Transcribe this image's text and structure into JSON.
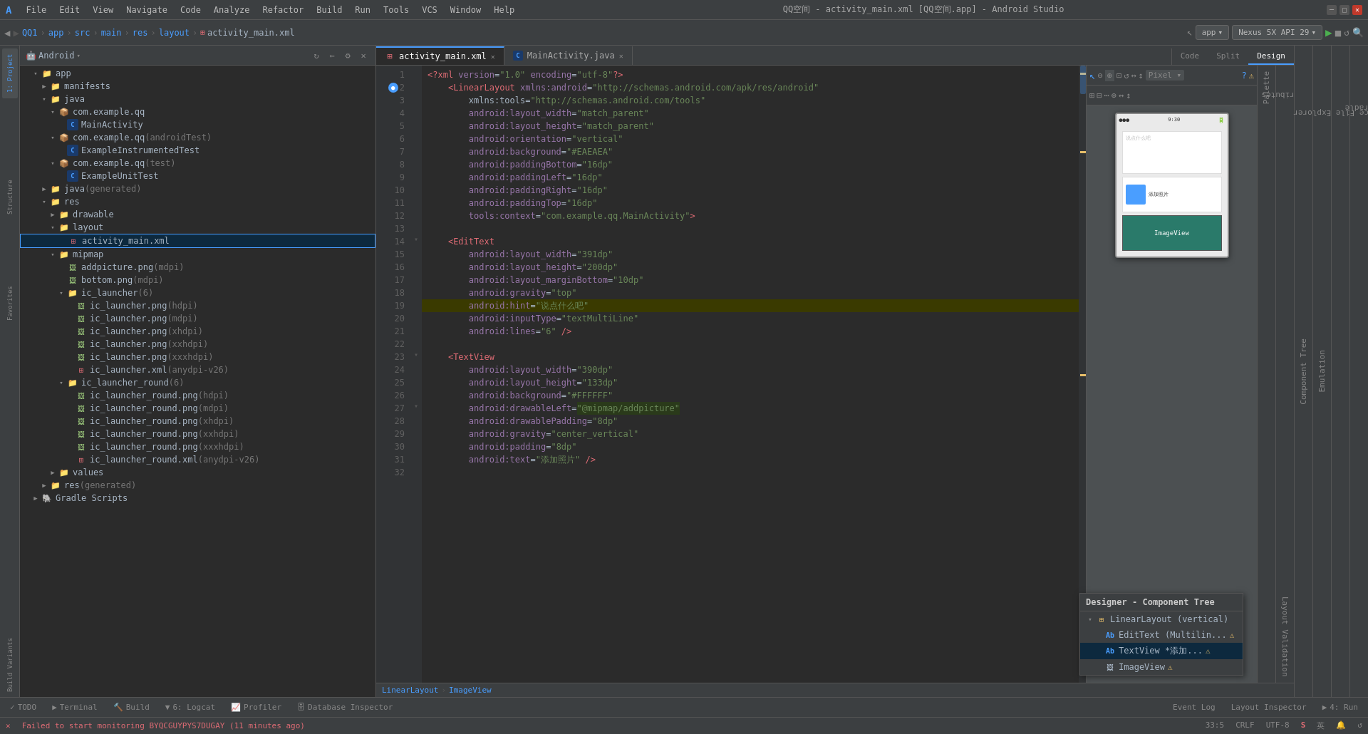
{
  "titleBar": {
    "title": "QQ空间 - activity_main.xml [QQ空间.app] - Android Studio",
    "menus": [
      "File",
      "Edit",
      "View",
      "Navigate",
      "Code",
      "Analyze",
      "Refactor",
      "Build",
      "Run",
      "Tools",
      "VCS",
      "Window",
      "Help"
    ]
  },
  "breadcrumb": {
    "items": [
      "QQ1",
      "app",
      "src",
      "main",
      "res",
      "layout",
      "activity_main.xml"
    ]
  },
  "tabs": [
    {
      "label": "activity_main.xml",
      "active": true
    },
    {
      "label": "MainActivity.java",
      "active": false
    }
  ],
  "rightTabs": [
    {
      "label": "Code",
      "active": false
    },
    {
      "label": "Split",
      "active": false
    },
    {
      "label": "Design",
      "active": true
    }
  ],
  "runConfig": {
    "app": "app",
    "device": "Nexus 5X API 29"
  },
  "projectTree": {
    "items": [
      {
        "label": "app",
        "indent": 1,
        "type": "folder",
        "expanded": true
      },
      {
        "label": "manifests",
        "indent": 2,
        "type": "folder",
        "expanded": false
      },
      {
        "label": "java",
        "indent": 2,
        "type": "folder",
        "expanded": true
      },
      {
        "label": "com.example.qq",
        "indent": 3,
        "type": "package",
        "expanded": true
      },
      {
        "label": "MainActivity",
        "indent": 4,
        "type": "java"
      },
      {
        "label": "com.example.qq (androidTest)",
        "indent": 3,
        "type": "package",
        "expanded": true
      },
      {
        "label": "ExampleInstrumentedTest",
        "indent": 4,
        "type": "java"
      },
      {
        "label": "com.example.qq (test)",
        "indent": 3,
        "type": "package",
        "expanded": true
      },
      {
        "label": "ExampleUnitTest",
        "indent": 4,
        "type": "java"
      },
      {
        "label": "java (generated)",
        "indent": 2,
        "type": "folder",
        "expanded": false
      },
      {
        "label": "res",
        "indent": 2,
        "type": "folder",
        "expanded": true
      },
      {
        "label": "drawable",
        "indent": 3,
        "type": "folder",
        "expanded": false
      },
      {
        "label": "layout",
        "indent": 3,
        "type": "folder",
        "expanded": true
      },
      {
        "label": "activity_main.xml",
        "indent": 4,
        "type": "xml",
        "selected": true
      },
      {
        "label": "mipmap",
        "indent": 3,
        "type": "folder",
        "expanded": true
      },
      {
        "label": "addpicture.png (mdpi)",
        "indent": 4,
        "type": "png"
      },
      {
        "label": "bottom.png (mdpi)",
        "indent": 4,
        "type": "png"
      },
      {
        "label": "ic_launcher (6)",
        "indent": 4,
        "type": "folder",
        "expanded": true
      },
      {
        "label": "ic_launcher.png (hdpi)",
        "indent": 5,
        "type": "png"
      },
      {
        "label": "ic_launcher.png (mdpi)",
        "indent": 5,
        "type": "png"
      },
      {
        "label": "ic_launcher.png (xhdpi)",
        "indent": 5,
        "type": "png"
      },
      {
        "label": "ic_launcher.png (xxhdpi)",
        "indent": 5,
        "type": "png"
      },
      {
        "label": "ic_launcher.png (xxxhdpi)",
        "indent": 5,
        "type": "png"
      },
      {
        "label": "ic_launcher.xml (anydpi-v26)",
        "indent": 5,
        "type": "xml"
      },
      {
        "label": "ic_launcher_round (6)",
        "indent": 4,
        "type": "folder",
        "expanded": true
      },
      {
        "label": "ic_launcher_round.png (hdpi)",
        "indent": 5,
        "type": "png"
      },
      {
        "label": "ic_launcher_round.png (mdpi)",
        "indent": 5,
        "type": "png"
      },
      {
        "label": "ic_launcher_round.png (xhdpi)",
        "indent": 5,
        "type": "png"
      },
      {
        "label": "ic_launcher_round.png (xxhdpi)",
        "indent": 5,
        "type": "png"
      },
      {
        "label": "ic_launcher_round.png (xxxhdpi)",
        "indent": 5,
        "type": "png"
      },
      {
        "label": "ic_launcher_round.xml (anydpi-v26)",
        "indent": 5,
        "type": "xml"
      },
      {
        "label": "values",
        "indent": 3,
        "type": "folder",
        "expanded": false
      },
      {
        "label": "res (generated)",
        "indent": 2,
        "type": "folder",
        "expanded": false
      },
      {
        "label": "Gradle Scripts",
        "indent": 1,
        "type": "folder",
        "expanded": false
      }
    ]
  },
  "codeLines": [
    {
      "num": 1,
      "text": "<?xml version=\"1.0\" encoding=\"utf-8\"?>"
    },
    {
      "num": 2,
      "text": "    <LinearLayout xmlns:android=\"http://schemas.android.com/apk/res/android\"",
      "marker": true
    },
    {
      "num": 3,
      "text": "        xmlns:tools=\"http://schemas.android.com/tools\""
    },
    {
      "num": 4,
      "text": "        android:layout_width=\"match_parent\""
    },
    {
      "num": 5,
      "text": "        android:layout_height=\"match_parent\""
    },
    {
      "num": 6,
      "text": "        android:orientation=\"vertical\""
    },
    {
      "num": 7,
      "text": "        android:background=\"#EAEAEA\""
    },
    {
      "num": 8,
      "text": "        android:paddingBottom=\"16dp\""
    },
    {
      "num": 9,
      "text": "        android:paddingLeft=\"16dp\""
    },
    {
      "num": 10,
      "text": "        android:paddingRight=\"16dp\""
    },
    {
      "num": 11,
      "text": "        android:paddingTop=\"16dp\""
    },
    {
      "num": 12,
      "text": "        tools:context=\"com.example.qq.MainActivity\">"
    },
    {
      "num": 13,
      "text": ""
    },
    {
      "num": 14,
      "text": "    <EditText"
    },
    {
      "num": 15,
      "text": "        android:layout_width=\"391dp\""
    },
    {
      "num": 16,
      "text": "        android:layout_height=\"200dp\""
    },
    {
      "num": 17,
      "text": "        android:layout_marginBottom=\"10dp\""
    },
    {
      "num": 18,
      "text": "        android:gravity=\"top\""
    },
    {
      "num": 19,
      "text": "        android:hint=\"说点什么吧\"",
      "highlighted": true
    },
    {
      "num": 20,
      "text": "        android:inputType=\"textMultiLine\""
    },
    {
      "num": 21,
      "text": "        android:lines=\"6\" />"
    },
    {
      "num": 22,
      "text": ""
    },
    {
      "num": 23,
      "text": "    <TextView"
    },
    {
      "num": 24,
      "text": "        android:layout_width=\"390dp\""
    },
    {
      "num": 25,
      "text": "        android:layout_height=\"133dp\""
    },
    {
      "num": 26,
      "text": "        android:background=\"#FFFFFF\""
    },
    {
      "num": 27,
      "text": "        android:drawableLeft=\"@mipmap/addpicture\"",
      "highlighted2": true
    },
    {
      "num": 28,
      "text": "        android:drawablePadding=\"8dp\""
    },
    {
      "num": 29,
      "text": "        android:gravity=\"center_vertical\""
    },
    {
      "num": 30,
      "text": "        android:padding=\"8dp\""
    },
    {
      "num": 31,
      "text": "        android:text=\"添加照片\" />"
    },
    {
      "num": 32,
      "text": ""
    }
  ],
  "componentTree": {
    "title": "Designer - Component Tree",
    "items": [
      {
        "label": "LinearLayout (vertical)",
        "indent": 0,
        "icon": "layout"
      },
      {
        "label": "EditText (Multilin...",
        "indent": 1,
        "icon": "edittext",
        "warn": true
      },
      {
        "label": "TextView *添加...   ",
        "indent": 1,
        "icon": "textview",
        "warn": true,
        "selected": true
      },
      {
        "label": "ImageView",
        "indent": 1,
        "icon": "imageview",
        "warn": true
      }
    ]
  },
  "editorBreadcrumb": {
    "items": [
      "LinearLayout",
      "ImageView"
    ]
  },
  "bottomTabs": [
    {
      "label": "TODO",
      "icon": "✓"
    },
    {
      "label": "Terminal",
      "icon": "▶"
    },
    {
      "label": "Build",
      "icon": "🔨"
    },
    {
      "label": "6: Logcat",
      "icon": "▼"
    },
    {
      "label": "Profiler",
      "icon": "📈"
    },
    {
      "label": "Database Inspector",
      "icon": "🗄"
    }
  ],
  "statusBar": {
    "error": "Failed to start monitoring BYQCGUYPYS7DUGAY (11 minutes ago)",
    "right": {
      "line": "33:5",
      "encoding": "CRLF",
      "charset": "UTF-8"
    }
  },
  "runTabs": [
    {
      "label": "4: Run",
      "icon": "▶"
    }
  ]
}
